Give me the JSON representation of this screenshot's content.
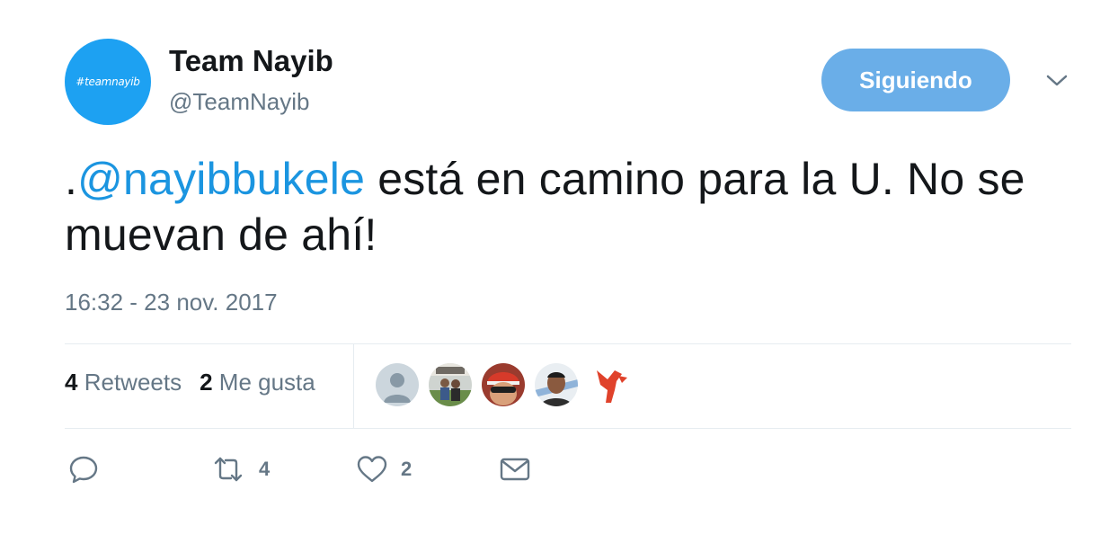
{
  "header": {
    "avatar_text": "#teamnayib",
    "name": "Team Nayib",
    "handle": "@TeamNayib",
    "follow_label": "Siguiendo"
  },
  "tweet": {
    "prefix": ".",
    "mention": "@nayibbukele",
    "text": " está en camino para la U. No se muevan de ahí!",
    "timestamp": "16:32 - 23 nov. 2017"
  },
  "stats": {
    "retweets_count": "4",
    "retweets_label": "Retweets",
    "likes_count": "2",
    "likes_label": "Me gusta"
  },
  "actions": {
    "retweet_count": "4",
    "like_count": "2"
  },
  "colors": {
    "accent": "#1da1f2",
    "mention": "#1b95e0",
    "follow_button": "#6aaee8",
    "muted": "#657786"
  },
  "icons": {
    "reply": "reply-icon",
    "retweet": "retweet-icon",
    "like": "heart-icon",
    "message": "envelope-icon",
    "caret": "chevron-down-icon"
  }
}
